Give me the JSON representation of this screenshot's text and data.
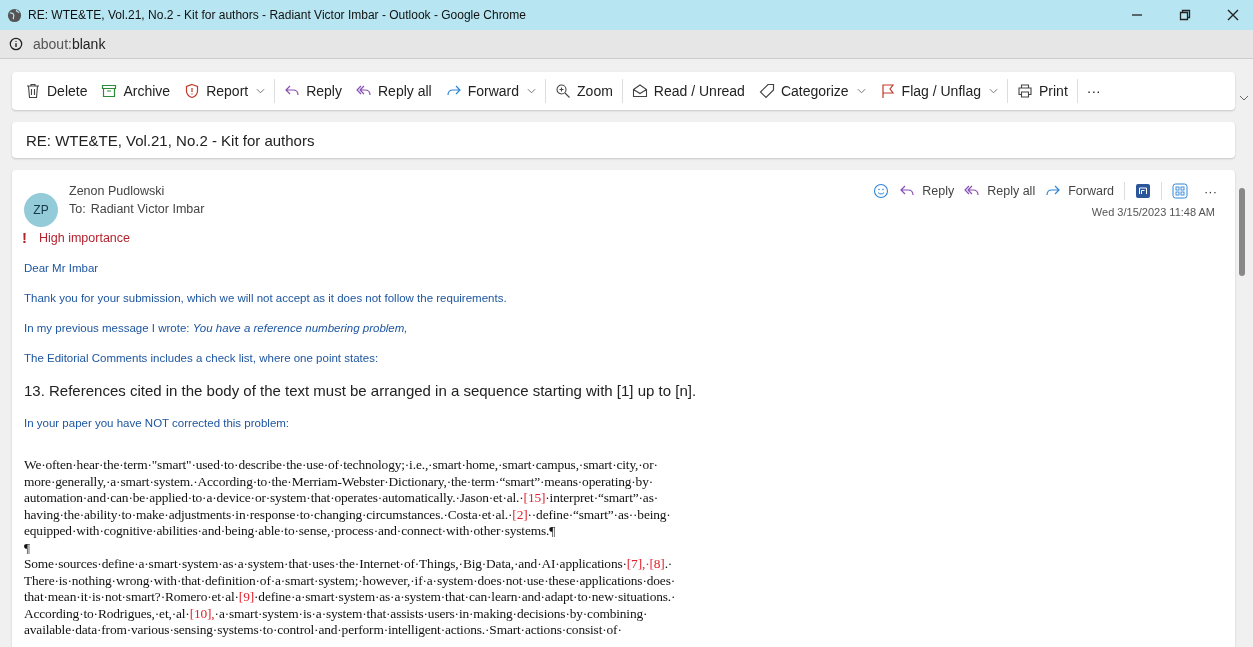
{
  "window": {
    "title": "RE: WTE&TE, Vol.21, No.2 - Kit for authors - Radiant Victor Imbar - Outlook - Google Chrome"
  },
  "address_bar": {
    "scheme": "about:",
    "path": "blank"
  },
  "toolbar": {
    "groups": [
      [
        {
          "label": "Delete",
          "kind": "delete",
          "dropdown": false
        },
        {
          "label": "Archive",
          "kind": "archive",
          "dropdown": false
        },
        {
          "label": "Report",
          "kind": "report",
          "dropdown": true
        }
      ],
      [
        {
          "label": "Reply",
          "kind": "reply",
          "dropdown": false
        },
        {
          "label": "Reply all",
          "kind": "replyall",
          "dropdown": false
        },
        {
          "label": "Forward",
          "kind": "forward",
          "dropdown": true
        }
      ],
      [
        {
          "label": "Zoom",
          "kind": "zoom",
          "dropdown": false
        }
      ],
      [
        {
          "label": "Read / Unread",
          "kind": "read",
          "dropdown": false
        },
        {
          "label": "Categorize",
          "kind": "categorize",
          "dropdown": true
        },
        {
          "label": "Flag / Unflag",
          "kind": "flag",
          "dropdown": true
        }
      ],
      [
        {
          "label": "Print",
          "kind": "print",
          "dropdown": false
        }
      ],
      [
        {
          "label": "···",
          "kind": "more",
          "dropdown": false
        }
      ]
    ]
  },
  "subject": "RE: WTE&TE, Vol.21, No.2 - Kit for authors",
  "message": {
    "avatar": "ZP",
    "sender": "Zenon Pudlowski",
    "to_label": "To:",
    "recipient": "Radiant Victor Imbar",
    "actions": [
      {
        "label": "Reply",
        "kind": "reply"
      },
      {
        "label": "Reply all",
        "kind": "replyall"
      },
      {
        "label": "Forward",
        "kind": "forward"
      }
    ],
    "more": "···",
    "date": "Wed 3/15/2023 11:48 AM",
    "importance_mark": "!",
    "importance": "High importance",
    "body": [
      {
        "kind": "small",
        "text": "Dear Mr Imbar"
      },
      {
        "kind": "small",
        "text": "Thank you for your submission, which we will not accept as it does not follow the requirements."
      },
      {
        "kind": "small",
        "text": "In my previous message I wrote: *You have a reference numbering problem,*"
      },
      {
        "kind": "small",
        "text": "The Editorial Comments includes a check list, where one point states:"
      },
      {
        "kind": "large",
        "text": "13. References cited in the body of the text must be arranged in a sequence starting with [1] up to [n]."
      },
      {
        "kind": "small",
        "text": "In your paper you have NOT corrected this problem:"
      }
    ],
    "excerpt": [
      [
        {
          "text": "We·often·hear·the·term·\"smart\"·used·to·describe·the·use·of·technology;·i.e.,·smart·home,·smart·campus,·smart·city,·or·",
          "citation": false
        }
      ],
      [
        {
          "text": "more·generally,·a·smart·system.·According·to·the·Merriam-Webster·Dictionary,·the·term·“smart”·means·operating·by·",
          "citation": false
        }
      ],
      [
        {
          "text": "automation·and·can·be·applied·to·a·device·or·system·that·operates·automatically.·Jason·et·al.·",
          "citation": false
        },
        {
          "text": "[15]",
          "citation": true
        },
        {
          "text": "·interpret·“smart”·as·",
          "citation": false
        }
      ],
      [
        {
          "text": "having·the·ability·to·make·adjustments·in·response·to·changing·circumstances.·Costa·et·al.·",
          "citation": false
        },
        {
          "text": "[2]",
          "citation": true
        },
        {
          "text": "··define·“smart”·as··being·",
          "citation": false
        }
      ],
      [
        {
          "text": "equipped·with·cognitive·abilities·and·being·able·to·sense,·process·and·connect·with·other·systems.¶",
          "citation": false
        }
      ],
      [
        {
          "text": "¶",
          "citation": false
        }
      ],
      [
        {
          "text": "Some·sources·define·a·smart·system·as·a·system·that·uses·the·Internet·of·Things,·Big·Data,·and·AI·applications·",
          "citation": false
        },
        {
          "text": "[7],·[8]",
          "citation": true
        },
        {
          "text": ".·",
          "citation": false
        }
      ],
      [
        {
          "text": "There·is·nothing·wrong·with·that·definition·of·a·smart·system;·however,·if·a·system·does·not·use·these·applications·does·",
          "citation": false
        }
      ],
      [
        {
          "text": "that·mean·it·is·not·smart?·Romero·et·al·",
          "citation": false
        },
        {
          "text": "[9]",
          "citation": true
        },
        {
          "text": "·define·a·smart·system·as·a·system·that·can·learn·and·adapt·to·new·situations.·",
          "citation": false
        }
      ],
      [
        {
          "text": "According·to·Rodrigues,·et,·al·",
          "citation": false
        },
        {
          "text": "[10],",
          "citation": true
        },
        {
          "text": "·a·smart·system·is·a·system·that·assists·users·in·making·decisions·by·combining·",
          "citation": false
        }
      ],
      [
        {
          "text": "available·data·from·various·sensing·systems·to·control·and·perform·intelligent·actions.·Smart·actions·consist·of·",
          "citation": false
        }
      ]
    ]
  }
}
